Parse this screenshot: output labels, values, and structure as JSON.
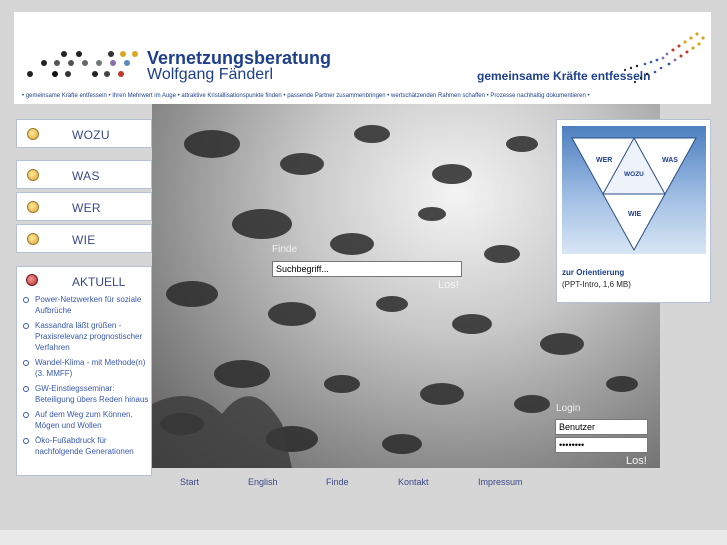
{
  "header": {
    "title": "Vernetzungsberatung",
    "subtitle": "Wolfgang Fänderl",
    "slogan": "gemeinsame Kräfte entfesseln",
    "tagline": "• gemeinsame Kräfte entfesseln • Ihren Mehrwert im Auge • attraktive Kristallisationspunkte finden • passende Partner zusammenbringen • wertschätzenden Rahmen schaffen • Prozesse nachhaltig dokumentieren •"
  },
  "nav": [
    {
      "label": "WOZU"
    },
    {
      "label": "WAS"
    },
    {
      "label": "WER"
    },
    {
      "label": "WIE"
    }
  ],
  "aktuell": {
    "title": "AKTUELL",
    "items": [
      "Power-Netzwerken für soziale Aufbrüche",
      "Kassandra läßt grüßen - Praxisrelevanz prognostischer Verfahren",
      "Wandel-Klima - mit Methode(n) (3. MMFF)",
      "GW-Einstiegsseminar: Beteiligung übers Reden hinaus",
      "Auf dem Weg zum Können, Mögen und Wollen",
      "Öko-Fußabdruck für nachfolgende Generationen"
    ]
  },
  "orientierung": {
    "link": "zur Orientierung",
    "info": "(PPT-Intro, 1,6 MB)",
    "diagram": {
      "wer": "WER",
      "was": "WAS",
      "wozu": "WOZU",
      "wie": "WIE"
    }
  },
  "search": {
    "label": "Finde",
    "value": "Suchbegriff...",
    "button": "Los!"
  },
  "login": {
    "label": "Login",
    "user_value": "Benutzer",
    "password_value": "••••••••",
    "button": "Los!"
  },
  "footer": {
    "links": [
      "Start",
      "English",
      "Finde",
      "Kontakt",
      "Impressum"
    ]
  },
  "colors": {
    "brand_blue": "#1e3f8c",
    "nav_text": "#3a4a88",
    "link_blue": "#3a58b0"
  }
}
